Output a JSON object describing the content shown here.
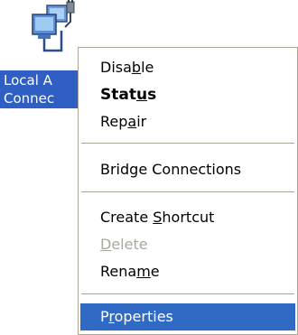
{
  "desktop_icon": {
    "label_line1": "Local A",
    "label_line2": "Connec",
    "icon": "network-connection-icon"
  },
  "context_menu": {
    "items": [
      {
        "pre": "Disa",
        "mnemonic": "b",
        "post": "le"
      },
      {
        "pre": "Stat",
        "mnemonic": "u",
        "post": "s"
      },
      {
        "pre": "Rep",
        "mnemonic": "a",
        "post": "ir"
      },
      {
        "pre": "",
        "mnemonic": "",
        "post": "Bridge Connections"
      },
      {
        "pre": "Create ",
        "mnemonic": "S",
        "post": "hortcut"
      },
      {
        "pre": "",
        "mnemonic": "D",
        "post": "elete"
      },
      {
        "pre": "Rena",
        "mnemonic": "m",
        "post": "e"
      },
      {
        "pre": "P",
        "mnemonic": "r",
        "post": "operties"
      }
    ]
  },
  "colors": {
    "selection": "#316ac5",
    "label_highlight": "#2f5fc2",
    "disabled_text": "#aca899"
  }
}
